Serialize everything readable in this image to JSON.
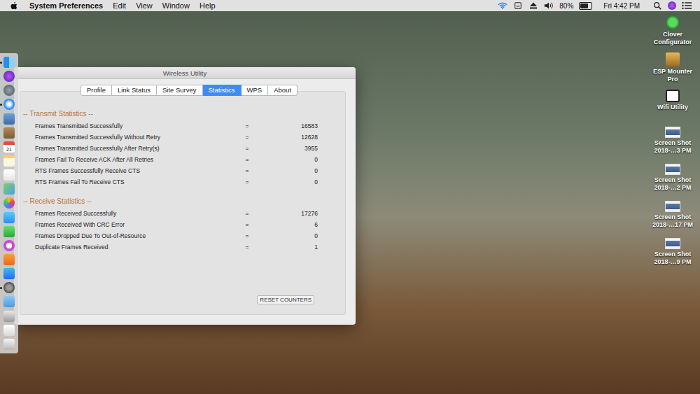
{
  "menu_bar": {
    "app_name": "System Preferences",
    "menus": [
      "Edit",
      "View",
      "Window",
      "Help"
    ],
    "battery": {
      "reading": "80%",
      "level": 0.8
    },
    "clock": "Fri 4:42 PM"
  },
  "window": {
    "title": "Wireless Utility",
    "tabs": [
      {
        "label": "Profile",
        "selected": false
      },
      {
        "label": "Link Status",
        "selected": false
      },
      {
        "label": "Site Survey",
        "selected": false
      },
      {
        "label": "Statistics",
        "selected": true
      },
      {
        "label": "WPS",
        "selected": false
      },
      {
        "label": "About",
        "selected": false
      }
    ],
    "separator": "=",
    "sections": [
      {
        "title": "-- Transmit Statistics --",
        "rows": [
          {
            "label": "Frames Transmitted Successfully",
            "value": "16583"
          },
          {
            "label": "Frames Transmitted Successfully Without Retry",
            "value": "12628"
          },
          {
            "label": "Frames Transmitted Successfully After Retry(s)",
            "value": "3955"
          },
          {
            "label": "Frames Fail To Receive ACK After All Retries",
            "value": "0"
          },
          {
            "label": "RTS Frames Successfully Receive CTS",
            "value": "0"
          },
          {
            "label": "RTS Frames Fail To Receive CTS",
            "value": "0"
          }
        ]
      },
      {
        "title": "-- Receive Statistics --",
        "rows": [
          {
            "label": "Frames Received Successfully",
            "value": "17276"
          },
          {
            "label": "Frames Received With CRC Error",
            "value": "6"
          },
          {
            "label": "Frames Dropped Due To Out-of-Resource",
            "value": "0"
          },
          {
            "label": "Duplicate Frames Received",
            "value": "1"
          }
        ]
      }
    ],
    "button": "RESET COUNTERS"
  },
  "dock": {
    "items": [
      {
        "kind": "finder",
        "running": true
      },
      {
        "kind": "siri",
        "running": false
      },
      {
        "kind": "launchpad",
        "running": false
      },
      {
        "kind": "safari",
        "running": true
      },
      {
        "kind": "preview",
        "running": false
      },
      {
        "kind": "contacts",
        "running": false
      },
      {
        "kind": "calendar",
        "running": false,
        "text": "21"
      },
      {
        "kind": "notes",
        "running": false
      },
      {
        "kind": "reminders",
        "running": false
      },
      {
        "kind": "maps",
        "running": false
      },
      {
        "kind": "photos",
        "running": false
      },
      {
        "kind": "messages",
        "running": false
      },
      {
        "kind": "facetime",
        "running": false
      },
      {
        "kind": "itunes",
        "running": false
      },
      {
        "kind": "ibooks",
        "running": false
      },
      {
        "kind": "appstore",
        "running": false
      },
      {
        "kind": "sysprefs",
        "running": true
      },
      {
        "kind": "folder",
        "running": false
      },
      {
        "kind": "drive",
        "running": false
      },
      {
        "kind": "document",
        "running": false
      },
      {
        "kind": "trash",
        "running": false
      }
    ]
  },
  "desktop_icons": [
    {
      "kind": "clover",
      "lines": [
        "Clover",
        "Configurator"
      ]
    },
    {
      "kind": "esp",
      "lines": [
        "ESP Mounter",
        "Pro"
      ]
    },
    {
      "kind": "wifi",
      "lines": [
        "Wifi Utility"
      ]
    },
    {
      "kind": "screenshot",
      "lines": [
        "Screen Shot",
        "2018-…3 PM"
      ]
    },
    {
      "kind": "screenshot",
      "lines": [
        "Screen Shot",
        "2018-…2 PM"
      ]
    },
    {
      "kind": "screenshot",
      "lines": [
        "Screen Shot",
        "2018-…17 PM"
      ]
    },
    {
      "kind": "screenshot",
      "lines": [
        "Screen Shot",
        "2018-…9 PM"
      ]
    }
  ]
}
